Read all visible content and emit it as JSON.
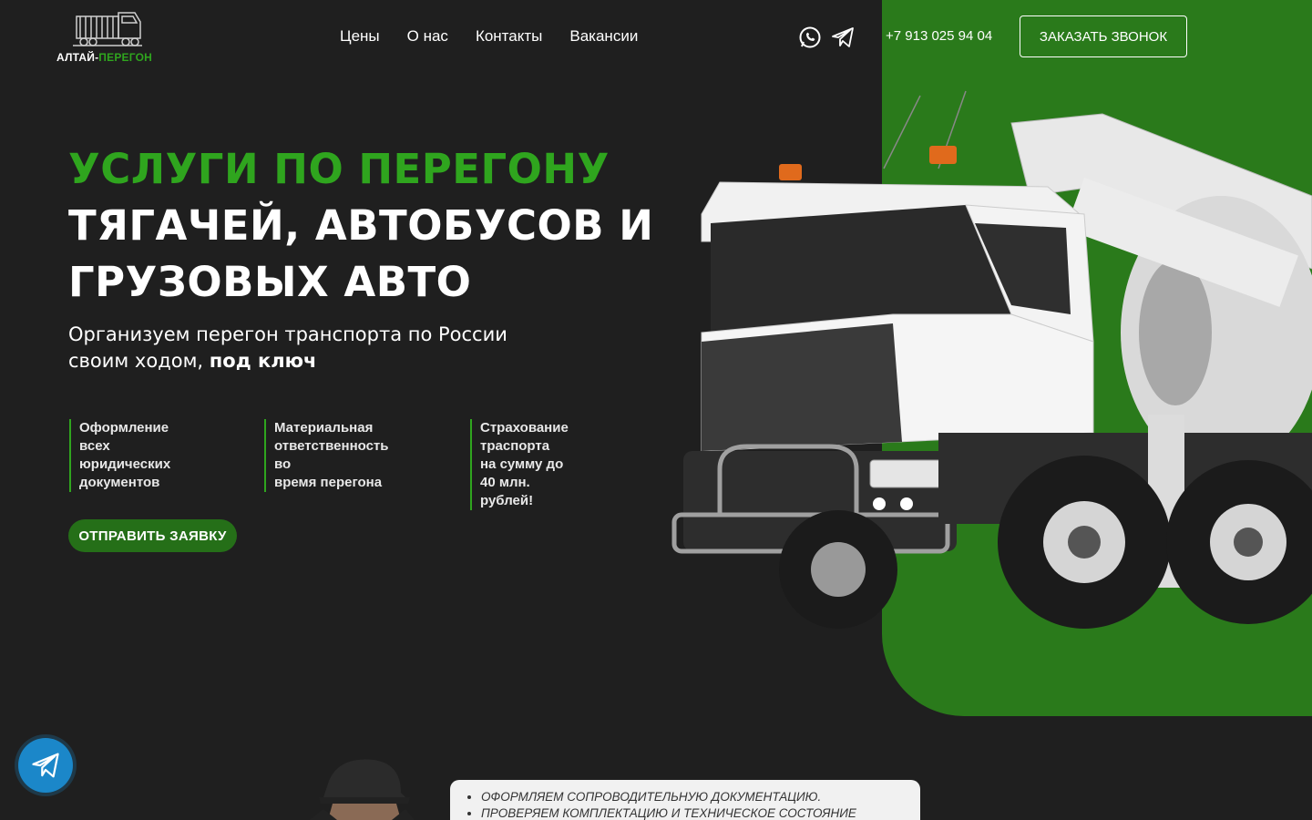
{
  "header": {
    "logo": {
      "text_main": "АЛТАЙ-",
      "text_accent": "ПЕРЕГОН"
    },
    "nav": [
      {
        "label": "Цены"
      },
      {
        "label": "О нас"
      },
      {
        "label": "Контакты"
      },
      {
        "label": "Вакансии"
      }
    ],
    "social_icons": [
      "whatsapp-icon",
      "telegram-icon"
    ],
    "phone": "+7 913 025 94 04",
    "call_button": "ЗАКАЗАТЬ ЗВОНОК"
  },
  "hero": {
    "title_line1": "УСЛУГИ ПО ПЕРЕГОНУ",
    "title_line2": "ТЯГАЧЕЙ, АВТОБУСОВ И",
    "title_line3": "ГРУЗОВЫХ АВТО",
    "subtitle_line1": "Организуем перегон транспорта по России",
    "subtitle_line2": "своим ходом,",
    "subtitle_bold": "под ключ",
    "features": [
      {
        "line1": "Оформление всех",
        "line2": "юридических",
        "line3": "документов"
      },
      {
        "line1": "Материальная",
        "line2": "ответственность во",
        "line3": "время перегона"
      },
      {
        "line1": "Страхование траспорта",
        "line2": "на сумму до 40 млн.",
        "line3": "рублей!"
      }
    ],
    "submit_button": "ОТПРАВИТЬ ЗАЯВКУ"
  },
  "bottom_card": {
    "items": [
      "ОФОРМЛЯЕМ СОПРОВОДИТЕЛЬНУЮ ДОКУМЕНТАЦИЮ.",
      "ПРОВЕРЯЕМ КОМПЛЕКТАЦИЮ И ТЕХНИЧЕСКОЕ СОСТОЯНИЕ"
    ]
  },
  "colors": {
    "background": "#1f1f1f",
    "accent_green": "#2fa51e",
    "panel_green": "#2a7a1b",
    "button_green": "#256f18",
    "telegram_blue": "#1b87c9"
  }
}
